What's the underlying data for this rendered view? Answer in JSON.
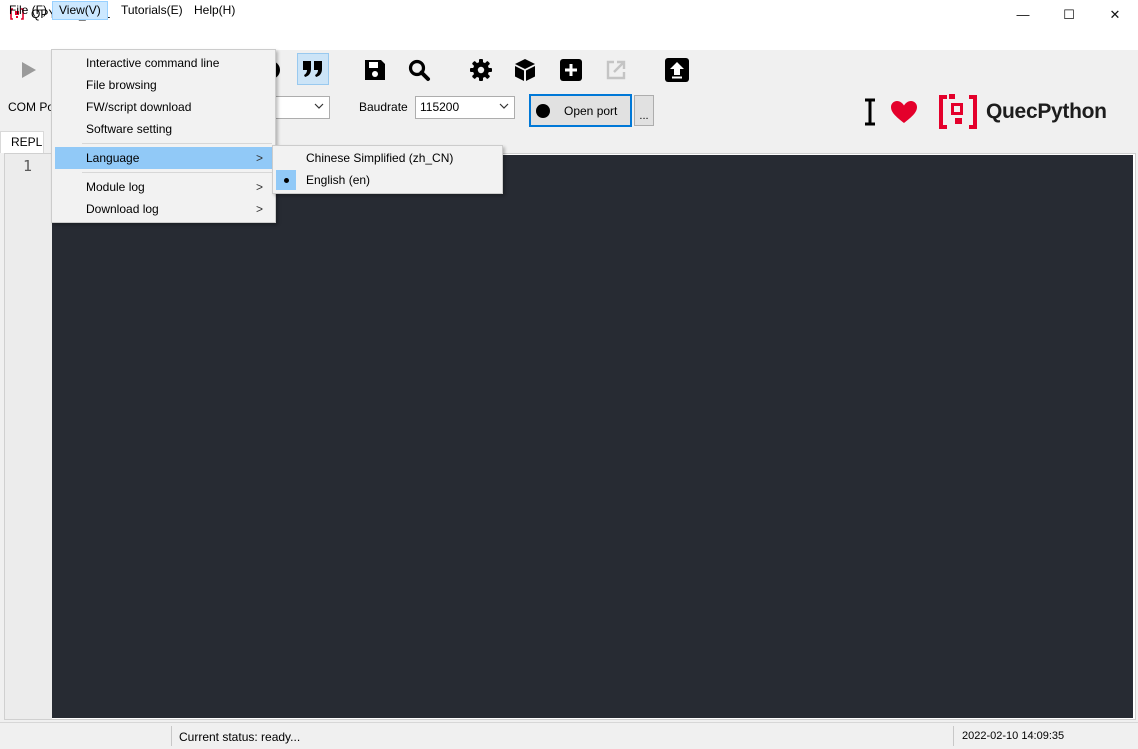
{
  "window": {
    "title": "QPYcom_V2.1",
    "minimize_glyph": "—",
    "maximize_glyph": "☐",
    "close_glyph": "✕"
  },
  "menubar": {
    "file": "File (F)",
    "view": "View(V)",
    "tutorials": "Tutorials(E)",
    "help": "Help(H)"
  },
  "view_menu": {
    "items": [
      {
        "label": "Interactive command line"
      },
      {
        "label": "File browsing"
      },
      {
        "label": "FW/script download"
      },
      {
        "label": "Software setting"
      },
      {
        "label": "Language",
        "submenu": true,
        "highlighted": true
      },
      {
        "label": "Module log",
        "submenu": true
      },
      {
        "label": "Download log",
        "submenu": true
      }
    ],
    "submenu_glyph": ">"
  },
  "language_menu": {
    "items": [
      {
        "label": "Chinese Simplified (zh_CN)",
        "checked": false
      },
      {
        "label": "English (en)",
        "checked": true
      }
    ]
  },
  "toolbar": {
    "icons": [
      "play-icon",
      "stop-icon",
      "quote-icon",
      "save-icon",
      "search-icon",
      "gear-icon",
      "package-icon",
      "add-icon",
      "export-icon",
      "upload-icon"
    ]
  },
  "port_row": {
    "com_port_label": "COM Po",
    "baudrate_label": "Baudrate",
    "baudrate_value": "115200",
    "open_port_label": "Open port",
    "more_label": "..."
  },
  "branding": {
    "logo_text": "QuecPython",
    "accent_color": "#e4002b"
  },
  "tabs": {
    "repl": "REPL"
  },
  "editor": {
    "line_number": "1",
    "background": "#272b33"
  },
  "status": {
    "text": "Current status: ready...",
    "timestamp": "2022-02-10 14:09:35"
  }
}
